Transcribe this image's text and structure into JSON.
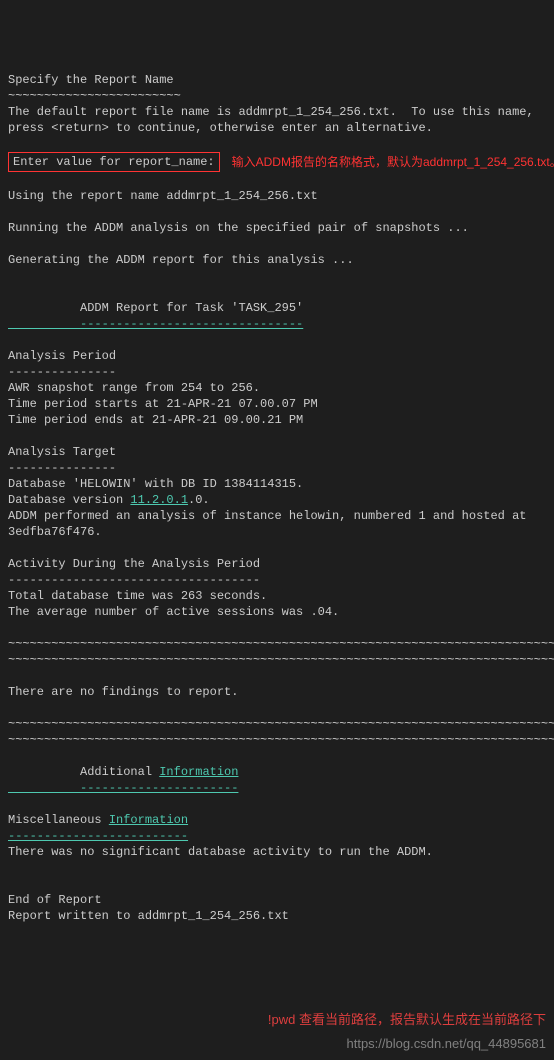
{
  "lines": {
    "l1": "Specify the Report Name",
    "l2": "~~~~~~~~~~~~~~~~~~~~~~~~",
    "l3": "The default report file name is addmrpt_1_254_256.txt.  To use this name,",
    "l4": "press <return> to continue, otherwise enter an alternative.",
    "prompt": "Enter value for report_name:",
    "anno1": "输入ADDM报告的名称格式，默认为addmrpt_1_254_256.txt。",
    "l5": "Using the report name addmrpt_1_254_256.txt",
    "l6": "Running the ADDM analysis on the specified pair of snapshots ...",
    "l7": "Generating the ADDM report for this analysis ...",
    "l8": "          ADDM Report for Task 'TASK_295'",
    "l9": "          -------------------------------",
    "l10": "Analysis Period",
    "l11": "---------------",
    "l12": "AWR snapshot range from 254 to 256.",
    "l13": "Time period starts at 21-APR-21 07.00.07 PM",
    "l14": "Time period ends at 21-APR-21 09.00.21 PM",
    "l15": "Analysis Target",
    "l16": "---------------",
    "l17a": "Database 'HELOWIN' with DB ID 1384114315.",
    "l18a": "Database version ",
    "l18b": "11.2.0.1",
    "l18c": ".0.",
    "l19": "ADDM performed an analysis of instance helowin, numbered 1 and hosted at",
    "l20": "3edfba76f476.",
    "l21": "Activity During the Analysis Period",
    "l22": "-----------------------------------",
    "l23": "Total database time was 263 seconds.",
    "l24": "The average number of active sessions was .04.",
    "l25": "~~~~~~~~~~~~~~~~~~~~~~~~~~~~~~~~~~~~~~~~~~~~~~~~~~~~~~~~~~~~~~~~~~~~~~~~~~~~~~",
    "l26": "~~~~~~~~~~~~~~~~~~~~~~~~~~~~~~~~~~~~~~~~~~~~~~~~~~~~~~~~~~~~~~~~~~~~~~~~~~~~~~",
    "l27": "There are no findings to report.",
    "l28": "~~~~~~~~~~~~~~~~~~~~~~~~~~~~~~~~~~~~~~~~~~~~~~~~~~~~~~~~~~~~~~~~~~~~~~~~~~~~~~",
    "l29": "~~~~~~~~~~~~~~~~~~~~~~~~~~~~~~~~~~~~~~~~~~~~~~~~~~~~~~~~~~~~~~~~~~~~~~~~~~~~~~",
    "l30a": "          Additional ",
    "l30b": "Information",
    "l31": "          ----------------------",
    "l32a": "Miscellaneous ",
    "l32b": "Information",
    "l33": "-------------------------",
    "l34": "There was no significant database activity to run the ADDM.",
    "l35": "End of Report",
    "l36": "Report written to addmrpt_1_254_256.txt",
    "anno2": "!pwd 查看当前路径，报告默认生成在当前路径下",
    "watermark": "https://blog.csdn.net/qq_44895681"
  }
}
